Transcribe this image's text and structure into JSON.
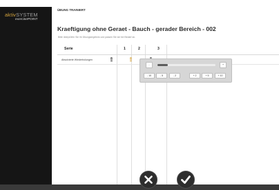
{
  "brand": {
    "aktiv": "aktiv",
    "system": "SYSTEM",
    "sub": "exercisePOINT"
  },
  "header": {
    "tab": "ÜBUNG TRAINIERT"
  },
  "page": {
    "title": "Kraeftigung ohne Geraet - Bauch - gerader Bereich - 002",
    "instruction": "Bitte überprüfen Sie Ihr Übungsergebnis und passen Sie sie bei Bedarf an."
  },
  "table": {
    "columns": [
      "Serie",
      "1",
      "2",
      "3"
    ],
    "rows": [
      {
        "label": "Absolvierte Wiederholungen",
        "values": [
          "8",
          "8",
          "8"
        ]
      }
    ]
  },
  "stepper": {
    "minus_label": "-",
    "plus_label": "+",
    "slider_fraction": 0.18,
    "steps": [
      "- 10",
      "- 5",
      "- 2",
      "+ 2",
      "+ 5",
      "+ 10"
    ]
  },
  "actions": {
    "cancel_icon": "close-icon",
    "confirm_icon": "check-icon"
  },
  "colors": {
    "brand_gold": "#d4a43e",
    "active_value": "#d6a238"
  }
}
